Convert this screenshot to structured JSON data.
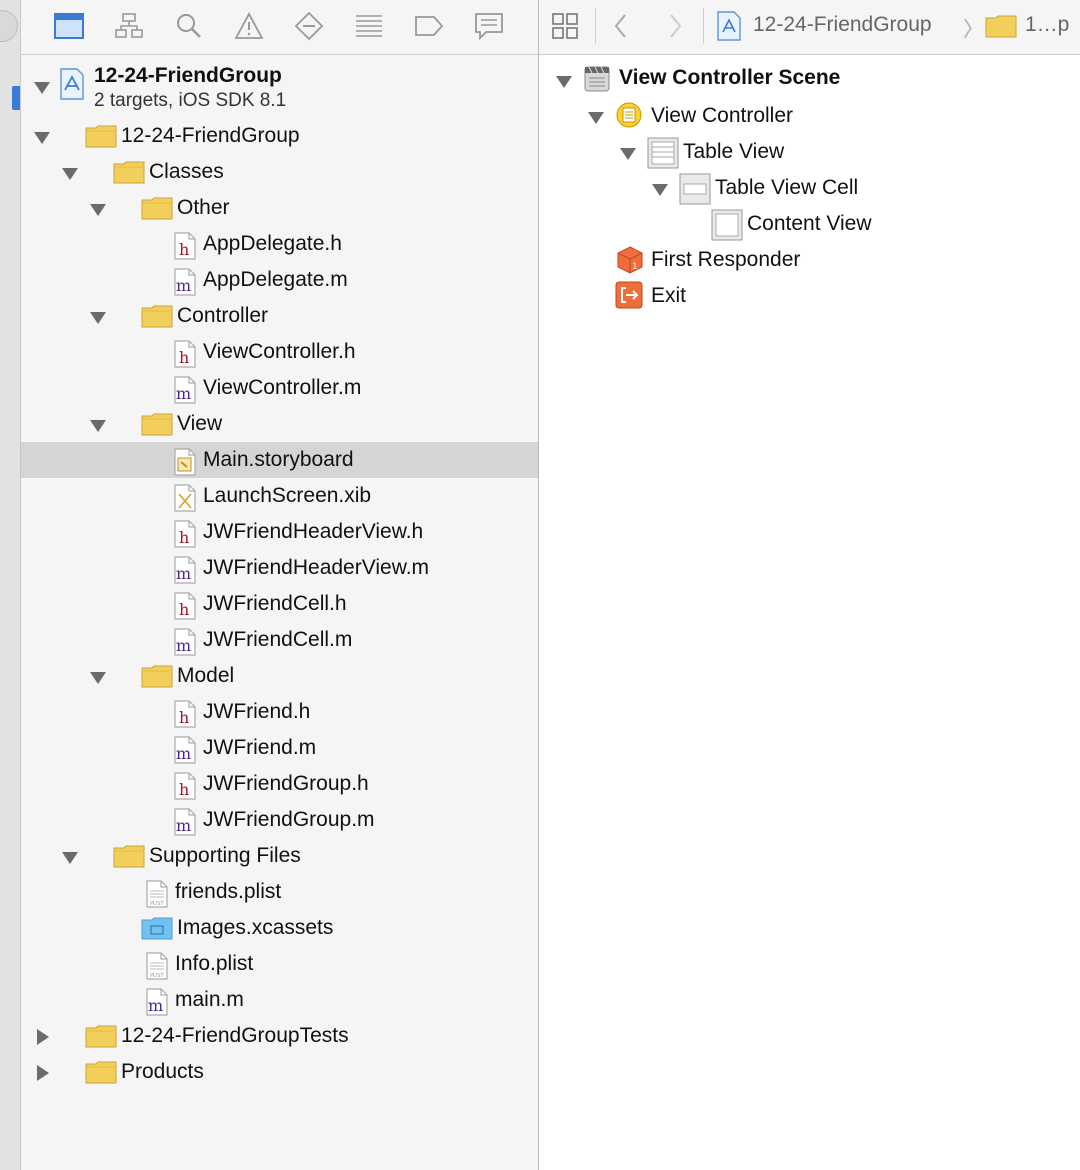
{
  "navigator": {
    "toolbar": [
      "project-navigator",
      "symbol-navigator",
      "find-navigator",
      "issue-navigator",
      "test-navigator",
      "debug-navigator",
      "breakpoint-navigator",
      "report-navigator"
    ],
    "project": {
      "name": "12-24-FriendGroup",
      "subtitle": "2 targets, iOS SDK 8.1"
    },
    "items": [
      {
        "label": "12-24-FriendGroup",
        "type": "folder",
        "expanded": true
      },
      {
        "label": "Classes",
        "type": "folder",
        "expanded": true
      },
      {
        "label": "Other",
        "type": "folder",
        "expanded": true
      },
      {
        "label": "AppDelegate.h",
        "type": "h"
      },
      {
        "label": "AppDelegate.m",
        "type": "m"
      },
      {
        "label": "Controller",
        "type": "folder",
        "expanded": true
      },
      {
        "label": "ViewController.h",
        "type": "h"
      },
      {
        "label": "ViewController.m",
        "type": "m"
      },
      {
        "label": "View",
        "type": "folder",
        "expanded": true
      },
      {
        "label": "Main.storyboard",
        "type": "storyboard",
        "selected": true
      },
      {
        "label": "LaunchScreen.xib",
        "type": "xib"
      },
      {
        "label": "JWFriendHeaderView.h",
        "type": "h"
      },
      {
        "label": "JWFriendHeaderView.m",
        "type": "m"
      },
      {
        "label": "JWFriendCell.h",
        "type": "h"
      },
      {
        "label": "JWFriendCell.m",
        "type": "m"
      },
      {
        "label": "Model",
        "type": "folder",
        "expanded": true
      },
      {
        "label": "JWFriend.h",
        "type": "h"
      },
      {
        "label": "JWFriend.m",
        "type": "m"
      },
      {
        "label": "JWFriendGroup.h",
        "type": "h"
      },
      {
        "label": "JWFriendGroup.m",
        "type": "m"
      },
      {
        "label": "Supporting Files",
        "type": "folder",
        "expanded": true
      },
      {
        "label": "friends.plist",
        "type": "plist"
      },
      {
        "label": "Images.xcassets",
        "type": "xcassets"
      },
      {
        "label": "Info.plist",
        "type": "plist"
      },
      {
        "label": "main.m",
        "type": "m"
      },
      {
        "label": "12-24-FriendGroupTests",
        "type": "folder",
        "expanded": false
      },
      {
        "label": "Products",
        "type": "folder",
        "expanded": false
      }
    ]
  },
  "jump_bar": {
    "project": "12-24-FriendGroup",
    "folder": "1…p"
  },
  "outline": {
    "items": [
      {
        "label": "View Controller Scene",
        "type": "scene",
        "expanded": true
      },
      {
        "label": "View Controller",
        "type": "viewcontroller",
        "expanded": true
      },
      {
        "label": "Table View",
        "type": "tableview",
        "expanded": true
      },
      {
        "label": "Table View Cell",
        "type": "tableviewcell",
        "expanded": true
      },
      {
        "label": "Content View",
        "type": "contentview"
      },
      {
        "label": "First Responder",
        "type": "firstresponder"
      },
      {
        "label": "Exit",
        "type": "exit"
      }
    ]
  },
  "colors": {
    "selection": "#d5d5d5",
    "folder": "#f2cf5b",
    "h_letter": "#a0182c",
    "m_letter": "#4b2a8c",
    "accent_blue": "#3a7bd5",
    "exit_orange": "#ef6f3c"
  }
}
